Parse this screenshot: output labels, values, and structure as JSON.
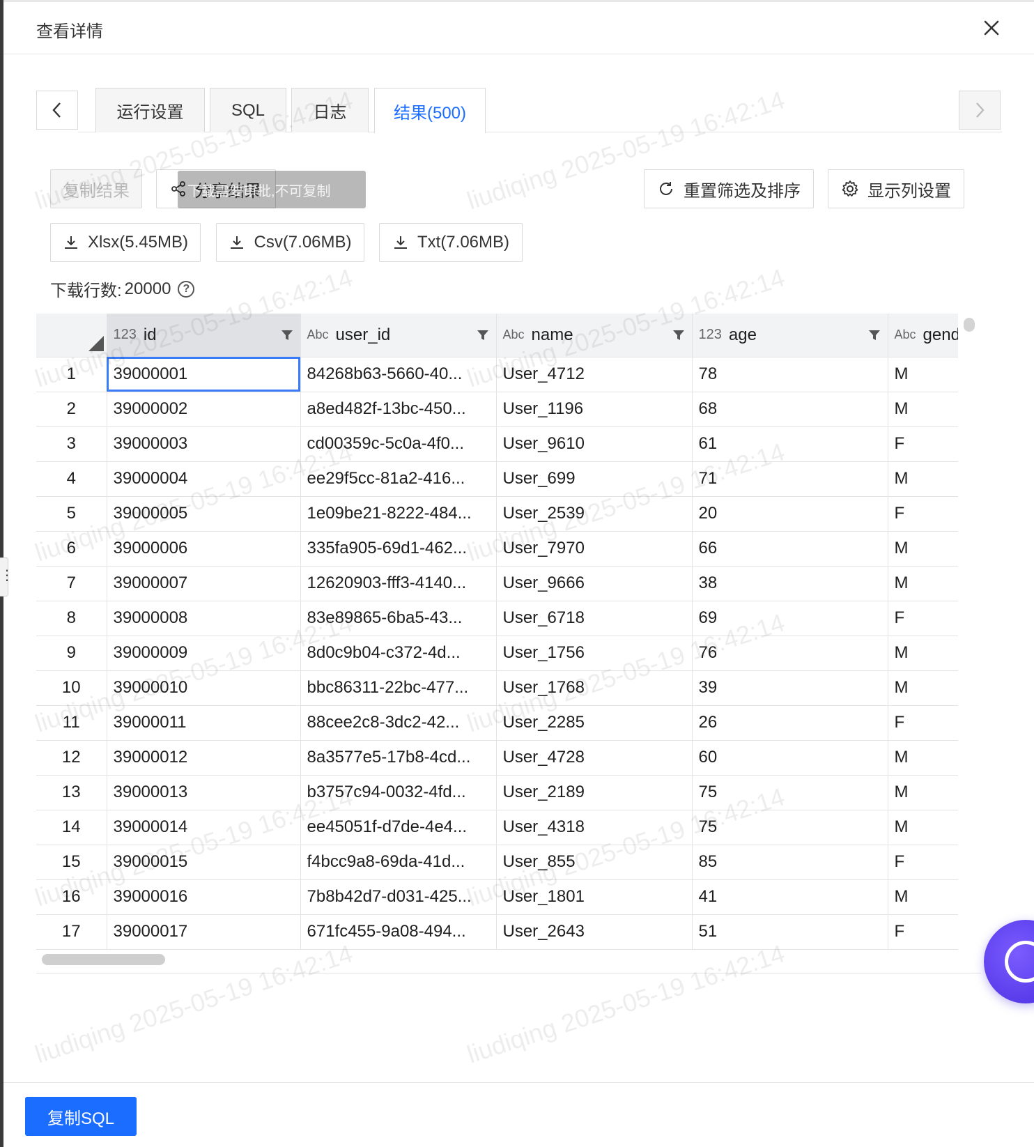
{
  "dialog": {
    "title": "查看详情"
  },
  "tabs": [
    {
      "label": "运行设置"
    },
    {
      "label": "SQL"
    },
    {
      "label": "日志"
    },
    {
      "label": "结果(500)"
    }
  ],
  "toolbar": {
    "copy_result": "复制结果",
    "share_result": "分享结果",
    "tooltip": "下载需要审批,不可复制",
    "reset_filter": "重置筛选及排序",
    "column_settings": "显示列设置"
  },
  "downloads": [
    {
      "label": "Xlsx(5.45MB)"
    },
    {
      "label": "Csv(7.06MB)"
    },
    {
      "label": "Txt(7.06MB)"
    }
  ],
  "download_rows": {
    "label": "下载行数:",
    "value": "20000"
  },
  "table": {
    "columns": [
      {
        "type": "123",
        "name": "id"
      },
      {
        "type": "Abc",
        "name": "user_id"
      },
      {
        "type": "Abc",
        "name": "name"
      },
      {
        "type": "123",
        "name": "age"
      },
      {
        "type": "Abc",
        "name": "gender"
      }
    ],
    "rows": [
      [
        "1",
        "39000001",
        "84268b63-5660-40...",
        "User_4712",
        "78",
        "M"
      ],
      [
        "2",
        "39000002",
        "a8ed482f-13bc-450...",
        "User_1196",
        "68",
        "M"
      ],
      [
        "3",
        "39000003",
        "cd00359c-5c0a-4f0...",
        "User_9610",
        "61",
        "F"
      ],
      [
        "4",
        "39000004",
        "ee29f5cc-81a2-416...",
        "User_699",
        "71",
        "M"
      ],
      [
        "5",
        "39000005",
        "1e09be21-8222-484...",
        "User_2539",
        "20",
        "F"
      ],
      [
        "6",
        "39000006",
        "335fa905-69d1-462...",
        "User_7970",
        "66",
        "M"
      ],
      [
        "7",
        "39000007",
        "12620903-fff3-4140...",
        "User_9666",
        "38",
        "M"
      ],
      [
        "8",
        "39000008",
        "83e89865-6ba5-43...",
        "User_6718",
        "69",
        "F"
      ],
      [
        "9",
        "39000009",
        "8d0c9b04-c372-4d...",
        "User_1756",
        "76",
        "M"
      ],
      [
        "10",
        "39000010",
        "bbc86311-22bc-477...",
        "User_1768",
        "39",
        "M"
      ],
      [
        "11",
        "39000011",
        "88cee2c8-3dc2-42...",
        "User_2285",
        "26",
        "F"
      ],
      [
        "12",
        "39000012",
        "8a3577e5-17b8-4cd...",
        "User_4728",
        "60",
        "M"
      ],
      [
        "13",
        "39000013",
        "b3757c94-0032-4fd...",
        "User_2189",
        "75",
        "M"
      ],
      [
        "14",
        "39000014",
        "ee45051f-d7de-4e4...",
        "User_4318",
        "75",
        "M"
      ],
      [
        "15",
        "39000015",
        "f4bcc9a8-69da-41d...",
        "User_855",
        "85",
        "F"
      ],
      [
        "16",
        "39000016",
        "7b8b42d7-d031-425...",
        "User_1801",
        "41",
        "M"
      ],
      [
        "17",
        "39000017",
        "671fc455-9a08-494...",
        "User_2643",
        "51",
        "F"
      ]
    ]
  },
  "footer": {
    "copy_sql": "复制SQL"
  },
  "watermark": "liudiqing 2025-05-19 16:42:14",
  "colors": {
    "accent": "#1a6dff",
    "border": "#d9d9d9"
  }
}
